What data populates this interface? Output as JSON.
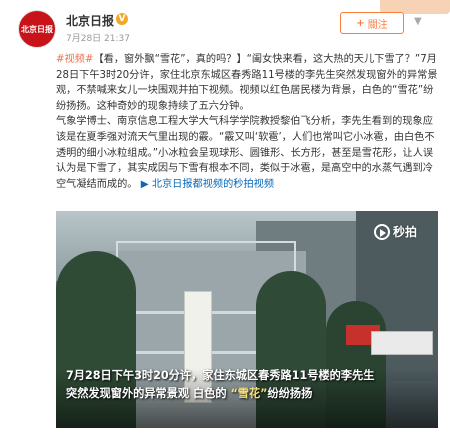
{
  "author": {
    "avatar_text": "北京日报",
    "name": "北京日报",
    "badge": "V",
    "timestamp": "7月28日 21:37"
  },
  "follow": {
    "plus": "+",
    "label": "關注"
  },
  "more_icon": "chevron-down-icon",
  "post": {
    "topic_link": "#视频#",
    "headline": "【看，窗外飘“雪花”，真的吗？】",
    "para1": "“阖女快来看，这大热的天儿下雪了？”7月28日下午3时20分许，家住北京东城区春秀路11号楼的李先生突然发现窗外的异常景观，不禁喊来女儿一块围观并拍下视频。视频以红色居民楼为背景，白色的“雪花”纷纷扬扬。这种奇妙的现象持续了五六分钟。",
    "para2_part1": "气象学博士、南京信息工程大学大气科学学院教授黎伯飞分析，李先生看到的现象应该是在夏季强对流天气里出现的霰。“霰又叫‘软雹’，人们也常叫它小冰雹，由白色不透明的细小冰粒组成。”小冰粒会呈现球形、圆锥形、长方形，甚至是雪花形，让人误认为是下雪了，其实成因与下雪有根本不同，类似于冰雹，是高空中的水蒸气遇到冷空气凝结而成的。",
    "video_link_icon": "play-circle-icon",
    "video_link_text": "北京日报都视频的秒拍视频"
  },
  "video": {
    "watermark": "秒拍",
    "caption_line1": "7月28日下午3时20分许，家住东城区春秀路11号楼的李先生",
    "caption_line2_pre": "突然发现窗外的异常景观  白色的",
    "caption_quote": "“雪花”",
    "caption_line2_post": "纷纷扬扬"
  },
  "colors": {
    "accent_orange": "#eb7350",
    "link_blue": "#0a68b6",
    "avatar_red": "#c8131a"
  }
}
